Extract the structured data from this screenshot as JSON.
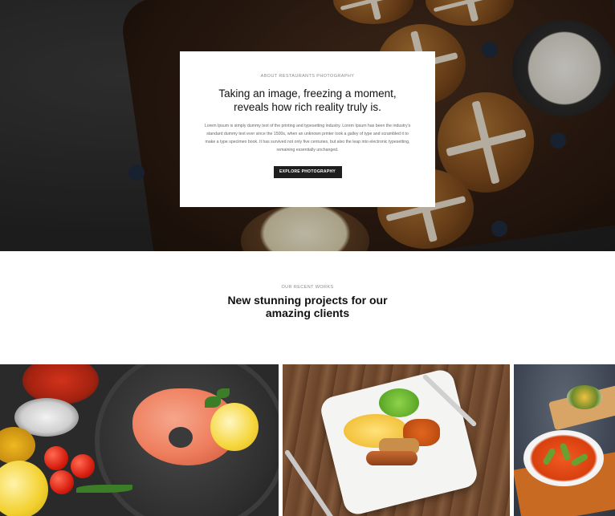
{
  "hero": {
    "eyebrow": "ABOUT RESTAURANTS PHOTOGRAPHY",
    "heading": "Taking an image, freezing a moment, reveals how rich reality truly is.",
    "body": "Lorem Ipsum is simply dummy text of the printing and typesetting industry. Lorem Ipsum has been the industry's standard dummy text ever since the 1500s, when an unknown printer took a galley of type and scrambled it to make a type specimen book. It has survived not only five centuries, but also the leap into electronic typesetting, remaining essentially unchanged.",
    "button_label": "EXPLORE PHOTOGRAPHY",
    "background_image": "hot-cross-buns-on-wooden-board"
  },
  "works": {
    "eyebrow": "OUR RECENT WORKS",
    "heading_line1": "New stunning projects for our",
    "heading_line2": "amazing clients"
  },
  "gallery": [
    {
      "image": "salmon-steak-in-pan-with-spices"
    },
    {
      "image": "breakfast-plate-on-wooden-table"
    },
    {
      "image": "tomato-okra-soup-bowl"
    }
  ],
  "colors": {
    "button_bg": "#1e1e1e",
    "heading_text": "#111111",
    "eyebrow_text": "#8a8a8a",
    "body_text": "#666666"
  }
}
